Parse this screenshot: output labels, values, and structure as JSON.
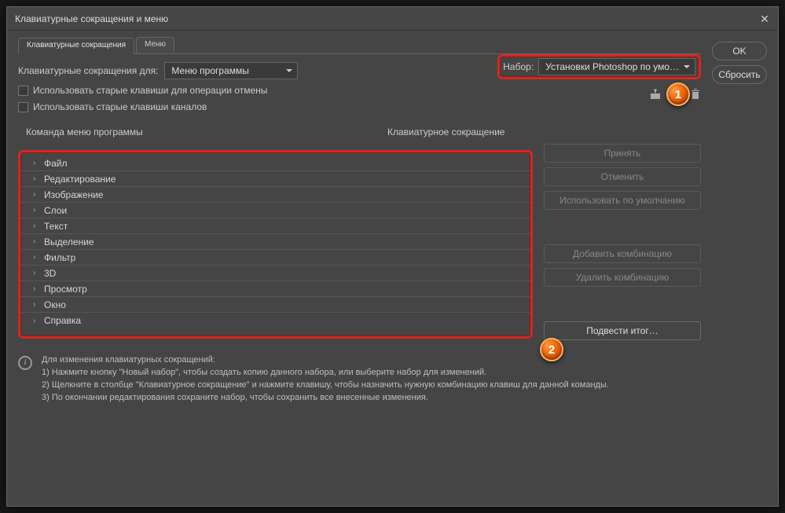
{
  "dialog": {
    "title": "Клавиатурные сокращения и меню"
  },
  "tabs": {
    "shortcuts": "Клавиатурные сокращения",
    "menus": "Меню"
  },
  "topbar": {
    "shortcuts_for_label": "Клавиатурные сокращения для:",
    "shortcuts_for_value": "Меню программы",
    "chk_undo": "Использовать старые клавиши для операции отмены",
    "chk_channels": "Использовать старые клавиши каналов",
    "set_label": "Набор:",
    "set_value": "Установки Photoshop по умо…"
  },
  "columns": {
    "command": "Команда меню программы",
    "shortcut": "Клавиатурное сокращение"
  },
  "tree": [
    "Файл",
    "Редактирование",
    "Изображение",
    "Слои",
    "Текст",
    "Выделение",
    "Фильтр",
    "3D",
    "Просмотр",
    "Окно",
    "Справка"
  ],
  "actions": {
    "accept": "Принять",
    "undo": "Отменить",
    "use_default": "Использовать по умолчанию",
    "add_combo": "Добавить комбинацию",
    "delete_combo": "Удалить комбинацию",
    "summarize": "Подвести итог…"
  },
  "sidebar": {
    "ok": "OK",
    "reset": "Сбросить"
  },
  "info": {
    "heading": "Для изменения клавиатурных сокращений:",
    "line1": "1) Нажмите кнопку \"Новый набор\", чтобы создать копию данного набора, или выберите набор для изменений.",
    "line2": "2) Щелкните в столбце \"Клавиатурное сокращение\" и нажмите клавишу, чтобы назначить нужную комбинацию клавиш для данной команды.",
    "line3": "3) По окончании редактирования сохраните набор, чтобы сохранить все внесенные изменения."
  },
  "badges": {
    "one": "1",
    "two": "2"
  }
}
